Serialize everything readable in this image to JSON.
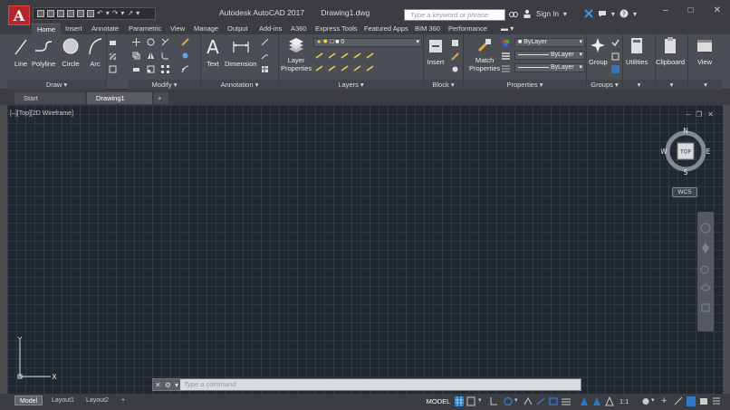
{
  "app": {
    "logo_letter": "A",
    "title": "Autodesk AutoCAD 2017",
    "document": "Drawing1.dwg"
  },
  "search": {
    "placeholder": "Type a keyword or phrase"
  },
  "account": {
    "sign_in": "Sign In"
  },
  "ribbon_tabs": [
    {
      "label": "Home",
      "active": true
    },
    {
      "label": "Insert"
    },
    {
      "label": "Annotate"
    },
    {
      "label": "Parametric"
    },
    {
      "label": "View"
    },
    {
      "label": "Manage"
    },
    {
      "label": "Output"
    },
    {
      "label": "Add-ins"
    },
    {
      "label": "A360"
    },
    {
      "label": "Express Tools"
    },
    {
      "label": "Featured Apps"
    },
    {
      "label": "BIM 360"
    },
    {
      "label": "Performance"
    }
  ],
  "ribbon": {
    "draw": {
      "title": "Draw",
      "tools": [
        "Line",
        "Polyline",
        "Circle",
        "Arc"
      ]
    },
    "modify": {
      "title": "Modify"
    },
    "annotation": {
      "title": "Annotation",
      "tools": [
        "Text",
        "Dimension"
      ]
    },
    "layers": {
      "title": "Layers",
      "tool_line1": "Layer",
      "tool_line2": "Properties",
      "current_layer": "0"
    },
    "block": {
      "title": "Block",
      "tools": [
        "Insert"
      ]
    },
    "properties": {
      "title": "Properties",
      "match_line1": "Match",
      "match_line2": "Properties",
      "color": "ByLayer",
      "linetype": "ByLayer",
      "lineweight": "ByLayer"
    },
    "groups": {
      "title": "Groups",
      "tools": [
        "Group"
      ]
    },
    "utilities": {
      "label": "Utilities"
    },
    "clipboard": {
      "label": "Clipboard"
    },
    "view": {
      "label": "View"
    }
  },
  "file_tabs": [
    {
      "label": "Start"
    },
    {
      "label": "Drawing1",
      "active": true
    }
  ],
  "viewport": {
    "label": "[–][Top][2D Wireframe]",
    "viewcube": {
      "north": "N",
      "south": "S",
      "east": "E",
      "west": "W",
      "face": "TOP"
    },
    "wcs": "WCS",
    "ucs": {
      "x": "X",
      "y": "Y"
    }
  },
  "command_line": {
    "placeholder": "Type a command"
  },
  "layout_tabs": [
    {
      "label": "Model",
      "active": true
    },
    {
      "label": "Layout1"
    },
    {
      "label": "Layout2"
    }
  ],
  "status": {
    "mode": "MODEL",
    "scale": "1:1"
  },
  "colors": {
    "accent_red": "#b3262b",
    "canvas": "#212830",
    "ribbon": "#4b4e54",
    "status_blue": "#2f78c8"
  }
}
